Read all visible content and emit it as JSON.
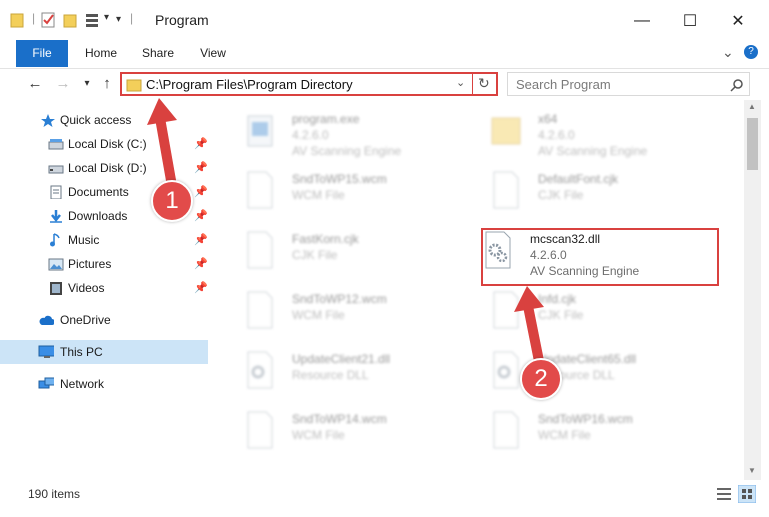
{
  "window": {
    "title": "Program",
    "minimize_glyph": "—",
    "maximize_glyph": "☐",
    "close_glyph": "✕"
  },
  "ribbon": {
    "tabs": [
      "File",
      "Home",
      "Share",
      "View"
    ],
    "expand_glyph": "⌄",
    "help_glyph": "?"
  },
  "address": {
    "path": "C:\\Program Files\\Program Directory",
    "search_placeholder": "Search Program"
  },
  "sidebar": {
    "items": [
      {
        "label": "Quick access",
        "icon": "star-icon"
      },
      {
        "label": "Local Disk (C:)",
        "icon": "drive-icon",
        "pinned": true
      },
      {
        "label": "Local Disk (D:)",
        "icon": "drive-icon",
        "pinned": true
      },
      {
        "label": "Documents",
        "icon": "documents-icon",
        "pinned": true
      },
      {
        "label": "Downloads",
        "icon": "downloads-icon",
        "pinned": true
      },
      {
        "label": "Music",
        "icon": "music-icon",
        "pinned": true
      },
      {
        "label": "Pictures",
        "icon": "pictures-icon",
        "pinned": true
      },
      {
        "label": "Videos",
        "icon": "videos-icon",
        "pinned": true
      },
      {
        "label": "OneDrive",
        "icon": "cloud-icon"
      },
      {
        "label": "This PC",
        "icon": "pc-icon",
        "selected": true
      },
      {
        "label": "Network",
        "icon": "network-icon"
      }
    ]
  },
  "files": [
    {
      "name": "program.exe",
      "line2": "4.2.6.0",
      "line3": "AV Scanning Engine",
      "icon": "exe-icon"
    },
    {
      "name": "x64",
      "line2": "4.2.6.0",
      "line3": "AV Scanning Engine",
      "icon": "folder-icon"
    },
    {
      "name": "SndToWP15.wcm",
      "line2": "WCM File",
      "line3": "",
      "icon": "file-icon"
    },
    {
      "name": "DefaultFont.cjk",
      "line2": "CJK File",
      "line3": "",
      "icon": "file-icon"
    },
    {
      "name": "FastKorn.cjk",
      "line2": "CJK File",
      "line3": "",
      "icon": "file-icon"
    },
    {
      "name": "mcscan32.dll",
      "line2": "4.2.6.0",
      "line3": "AV Scanning Engine",
      "icon": "dll-gear-icon"
    },
    {
      "name": "SndToWP12.wcm",
      "line2": "WCM File",
      "line3": "",
      "icon": "file-icon"
    },
    {
      "name": "Infd.cjk",
      "line2": "CJK File",
      "line3": "",
      "icon": "file-icon"
    },
    {
      "name": "UpdateClient21.dll",
      "line2": "Resource DLL",
      "line3": "",
      "icon": "dll-gear-icon"
    },
    {
      "name": "UpdateClient65.dll",
      "line2": "Resource DLL",
      "line3": "",
      "icon": "dll-gear-icon"
    },
    {
      "name": "SndToWP14.wcm",
      "line2": "WCM File",
      "line3": "",
      "icon": "file-icon"
    },
    {
      "name": "SndToWP16.wcm",
      "line2": "WCM File",
      "line3": "",
      "icon": "file-icon"
    }
  ],
  "status": {
    "item_count": "190 items"
  },
  "annotations": {
    "step1": "1",
    "step2": "2",
    "highlight_color": "#d9413f",
    "marker_color": "#e24b4a"
  }
}
